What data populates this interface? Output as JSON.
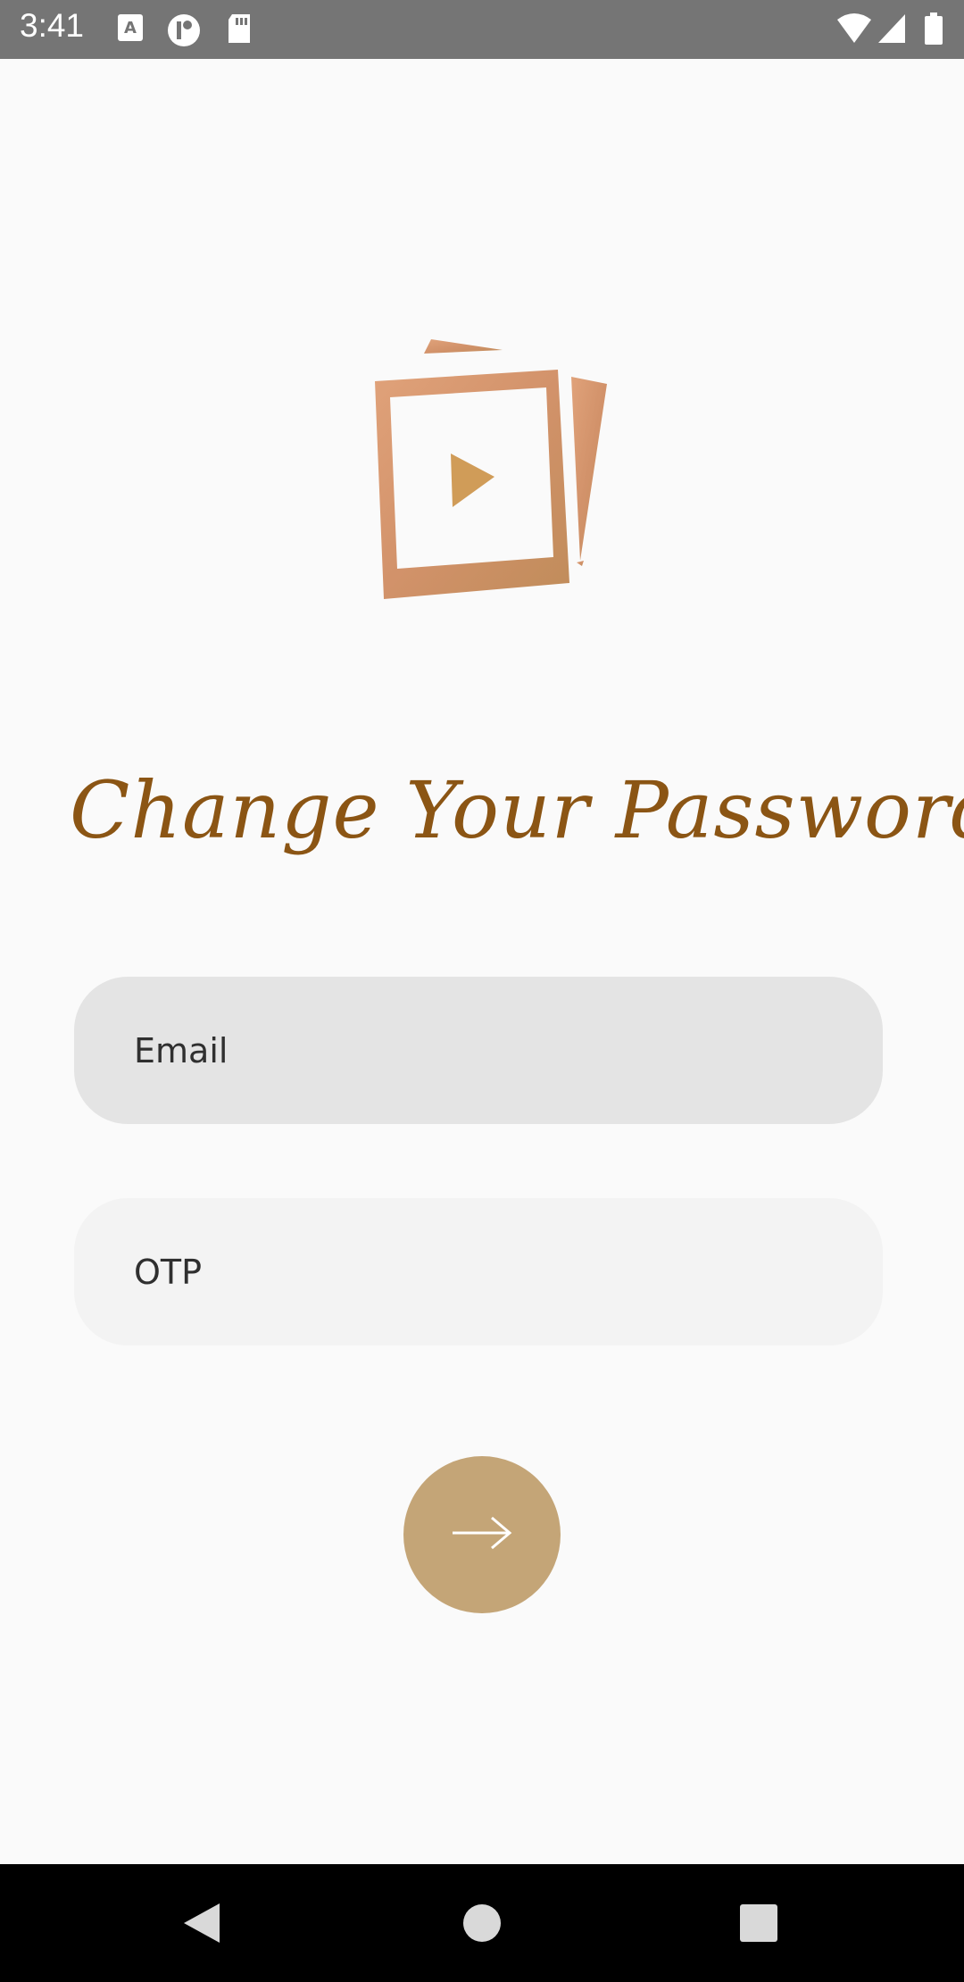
{
  "status_bar": {
    "time": "3:41",
    "left_icons": [
      "keyboard-a-icon",
      "circle-app-icon",
      "sd-card-icon"
    ],
    "right_icons": [
      "wifi-icon",
      "signal-icon",
      "battery-icon"
    ]
  },
  "screen": {
    "logo": "polaroid-play-logo",
    "title": "Change Your Password",
    "form": {
      "email_placeholder": "Email",
      "otp_placeholder": "OTP"
    },
    "submit": {
      "icon": "arrow-right-icon"
    }
  },
  "nav_bar": {
    "buttons": [
      "back-triangle-icon",
      "home-circle-icon",
      "recents-square-icon"
    ]
  },
  "colors": {
    "status_bar": "#757575",
    "background": "#fafafa",
    "title": "#8b5514",
    "email_field": "#e4e4e4",
    "otp_field": "#f3f3f3",
    "submit_button": "#c4a577",
    "nav_bar": "#000000"
  }
}
